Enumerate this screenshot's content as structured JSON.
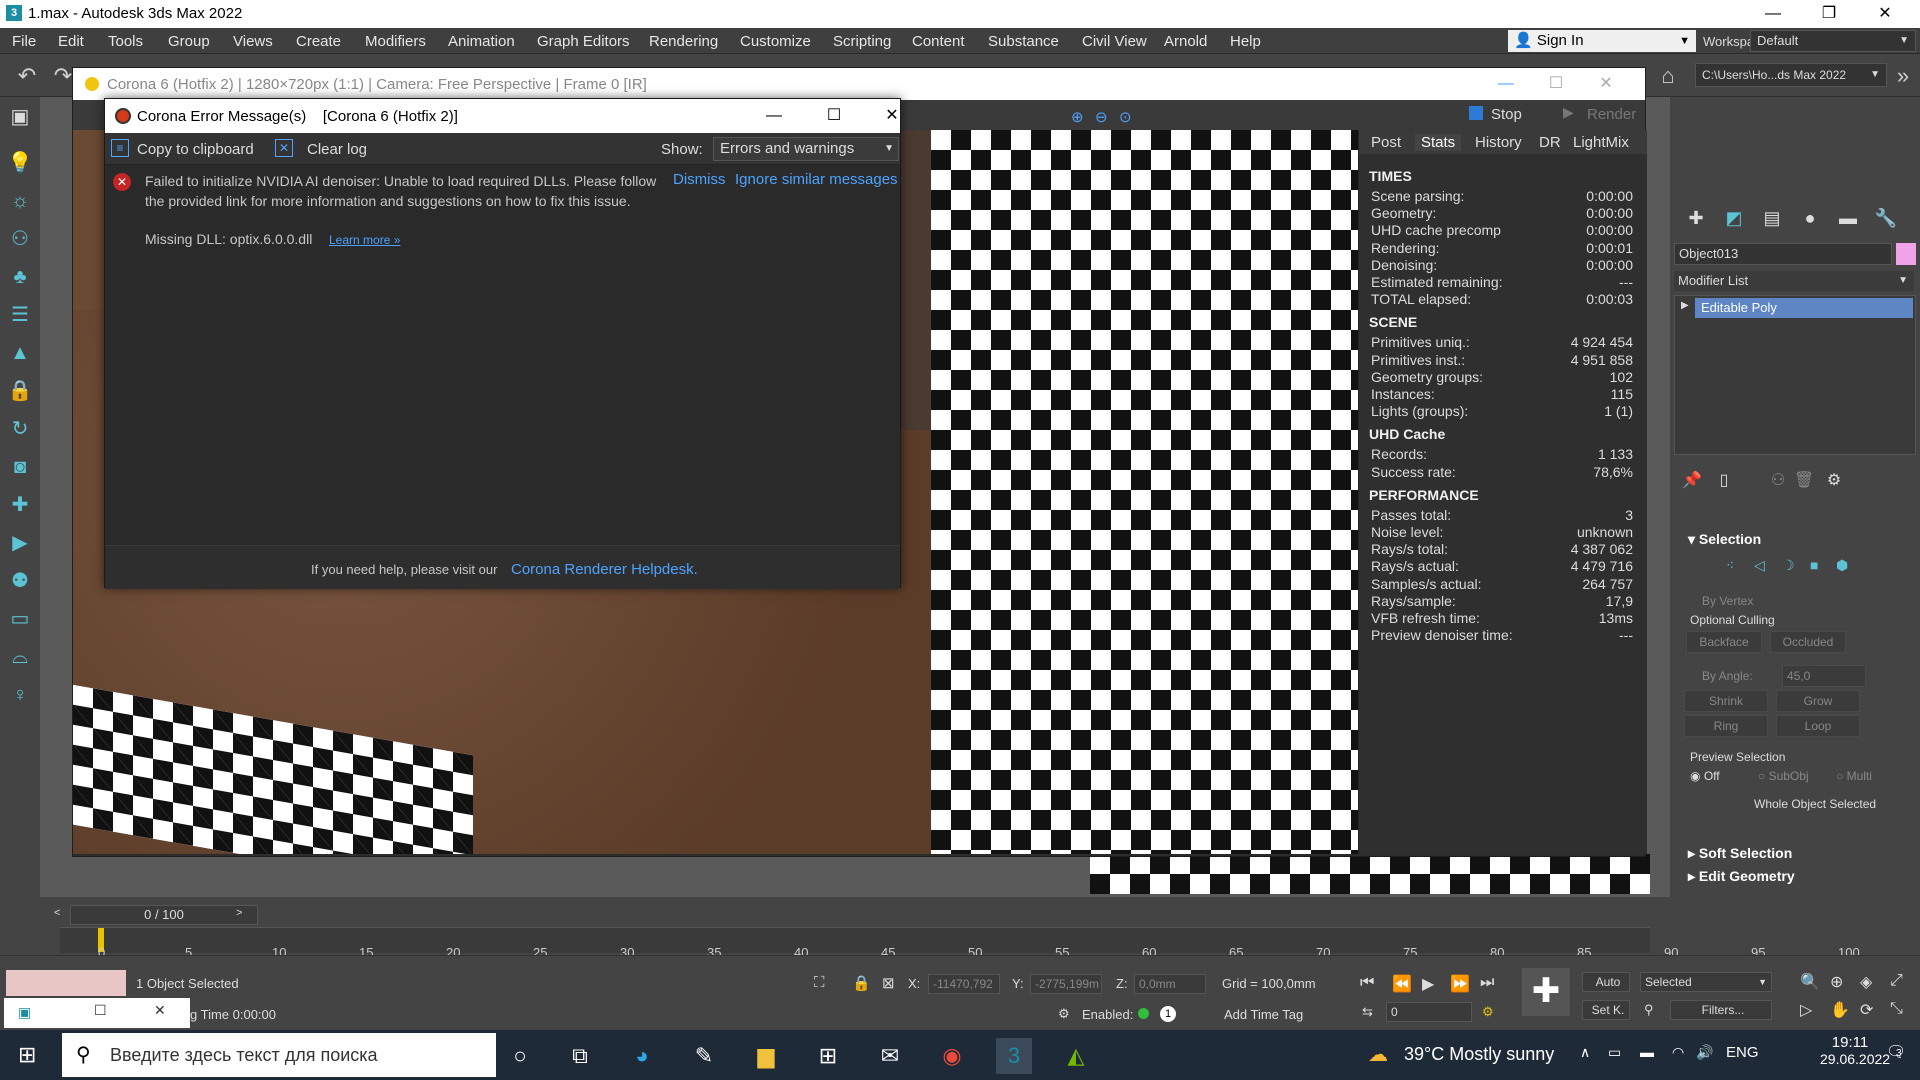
{
  "app": {
    "title": "1.max - Autodesk 3ds Max 2022",
    "icon_label": "3"
  },
  "menu": [
    "File",
    "Edit",
    "Tools",
    "Group",
    "Views",
    "Create",
    "Modifiers",
    "Animation",
    "Graph Editors",
    "Rendering",
    "Customize",
    "Scripting",
    "Content",
    "Substance",
    "Civil View",
    "Arnold",
    "Help"
  ],
  "signin": "Sign In",
  "workspaces": {
    "label": "Workspaces:",
    "value": "Default"
  },
  "path": "C:\\Users\\Ho...ds Max 2022",
  "vfb": {
    "title": "Corona 6 (Hotfix 2) | 1280×720px (1:1) | Camera: Free Perspective | Frame 0 [IR]",
    "stop": "Stop",
    "render": "Render",
    "tabs": [
      "Post",
      "Stats",
      "History",
      "DR",
      "LightMix"
    ],
    "active_tab": "Stats",
    "sections": [
      {
        "title": "TIMES",
        "rows": [
          {
            "label": "Scene parsing:",
            "value": "0:00:00"
          },
          {
            "label": "Geometry:",
            "value": "0:00:00"
          },
          {
            "label": "UHD cache precomp",
            "value": "0:00:00"
          },
          {
            "label": "Rendering:",
            "value": "0:00:01"
          },
          {
            "label": "Denoising:",
            "value": "0:00:00"
          },
          {
            "label": "Estimated remaining:",
            "value": "---"
          },
          {
            "label": "TOTAL elapsed:",
            "value": "0:00:03"
          }
        ]
      },
      {
        "title": "SCENE",
        "rows": [
          {
            "label": "Primitives uniq.:",
            "value": "4 924 454"
          },
          {
            "label": "Primitives inst.:",
            "value": "4 951 858"
          },
          {
            "label": "Geometry groups:",
            "value": "102"
          },
          {
            "label": "Instances:",
            "value": "115"
          },
          {
            "label": "Lights (groups):",
            "value": "1 (1)"
          }
        ]
      },
      {
        "title": "UHD Cache",
        "rows": [
          {
            "label": "Records:",
            "value": "1 133"
          },
          {
            "label": "Success rate:",
            "value": "78,6%"
          }
        ]
      },
      {
        "title": "PERFORMANCE",
        "rows": [
          {
            "label": "Passes total:",
            "value": "3"
          },
          {
            "label": "Noise level:",
            "value": "unknown"
          },
          {
            "label": "Rays/s total:",
            "value": "4 387 062"
          },
          {
            "label": "Rays/s actual:",
            "value": "4 479 716"
          },
          {
            "label": "Samples/s actual:",
            "value": "264 757"
          },
          {
            "label": "Rays/sample:",
            "value": "17,9"
          },
          {
            "label": "VFB refresh time:",
            "value": "13ms"
          },
          {
            "label": "Preview denoiser time:",
            "value": "---"
          }
        ]
      }
    ]
  },
  "error_dialog": {
    "title": "Corona Error Message(s)    [Corona 6 (Hotfix 2)]",
    "copy": "Copy to clipboard",
    "clear": "Clear log",
    "show_label": "Show:",
    "show_value": "Errors and warnings",
    "message": "Failed to initialize NVIDIA AI denoiser: Unable to load required DLLs. Please follow the provided link for more information and suggestions on how to fix this issue.",
    "missing_dll": "Missing DLL: optix.6.0.0.dll",
    "learn_more": "Learn more »",
    "dismiss": "Dismiss",
    "ignore": "Ignore similar messages",
    "help_text": "If you need help, please visit our",
    "help_link": "Corona Renderer Helpdesk."
  },
  "command_panel": {
    "object_name": "Object013",
    "object_color": "#f1a3e8",
    "modifier_list": "Modifier List",
    "stack_item": "Editable Poly",
    "selection_title": "Selection",
    "by_vertex": "By Vertex",
    "optional_culling": "Optional Culling",
    "backface": "Backface",
    "occluded": "Occluded",
    "by_angle": "By Angle:",
    "angle_value": "45,0",
    "shrink": "Shrink",
    "grow": "Grow",
    "ring": "Ring",
    "loop": "Loop",
    "preview_selection": "Preview Selection",
    "off": "Off",
    "subobj": "SubObj",
    "multi": "Multi",
    "whole_object": "Whole Object Selected",
    "soft_selection": "Soft Selection",
    "edit_geometry": "Edit Geometry"
  },
  "timeline": {
    "slider": "0 / 100",
    "ticks": [
      "0",
      "5",
      "10",
      "15",
      "20",
      "25",
      "30",
      "35",
      "40",
      "45",
      "50",
      "55",
      "60",
      "65",
      "70",
      "75",
      "80",
      "85",
      "90",
      "95",
      "100"
    ]
  },
  "status": {
    "selected": "1 Object Selected",
    "time": "g Time  0:00:00",
    "x_label": "X:",
    "x_value": "-11470,792",
    "y_label": "Y:",
    "y_value": "-2775,199m",
    "z_label": "Z:",
    "z_value": "0,0mm",
    "grid": "Grid = 100,0mm",
    "enabled": "Enabled:",
    "add_time_tag": "Add Time Tag",
    "auto": "Auto",
    "selected_dd": "Selected",
    "setk": "Set K.",
    "filters": "Filters...",
    "frame": "0"
  },
  "taskbar": {
    "search_placeholder": "Введите здесь текст для поиска",
    "weather": "39°C  Mostly sunny",
    "lang": "ENG",
    "time": "19:11",
    "date": "29.06.2022",
    "notif_count": "3"
  }
}
